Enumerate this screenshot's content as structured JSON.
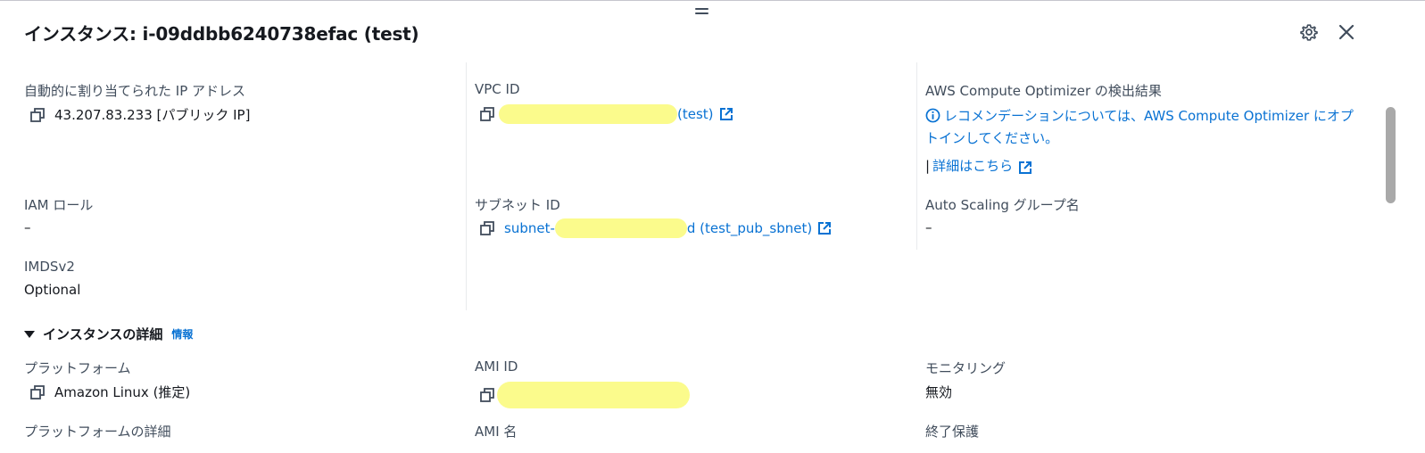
{
  "panel": {
    "title": "インスタンス: i-09ddbb6240738efac (test)"
  },
  "row1": {
    "auto_ip_label": "自動的に割り当てられた IP アドレス",
    "auto_ip_value": "43.207.83.233 [パブリック IP]",
    "vpc_label": "VPC ID",
    "vpc_value_suffix": "(test)",
    "optimizer_label": "AWS Compute Optimizer の検出結果",
    "optimizer_text": "レコメンデーションについては、AWS Compute Optimizer にオプトインしてください。",
    "optimizer_separator": "|",
    "optimizer_more": "詳細はこちら"
  },
  "row2": {
    "iam_label": "IAM ロール",
    "iam_value": "–",
    "subnet_label": "サブネット ID",
    "subnet_value_prefix": "subnet-",
    "subnet_value_suffix": "d (test_pub_sbnet)",
    "asg_label": "Auto Scaling グループ名",
    "asg_value": "–"
  },
  "row3": {
    "imds_label": "IMDSv2",
    "imds_value": "Optional"
  },
  "details_section": {
    "heading": "インスタンスの詳細",
    "info": "情報",
    "platform_label": "プラットフォーム",
    "platform_value": "Amazon Linux (推定)",
    "ami_id_label": "AMI ID",
    "monitoring_label": "モニタリング",
    "monitoring_value": "無効",
    "platform_details_label": "プラットフォームの詳細",
    "ami_name_label": "AMI 名",
    "termination_label": "終了保護"
  },
  "icons": {
    "copy": "copy-icon",
    "external": "external-link-icon",
    "info": "info-icon",
    "settings": "gear-icon",
    "close": "close-icon"
  },
  "colors": {
    "link": "#0972d3",
    "text": "#16191f",
    "label": "#414d5c",
    "redaction": "#fbfb8c"
  }
}
